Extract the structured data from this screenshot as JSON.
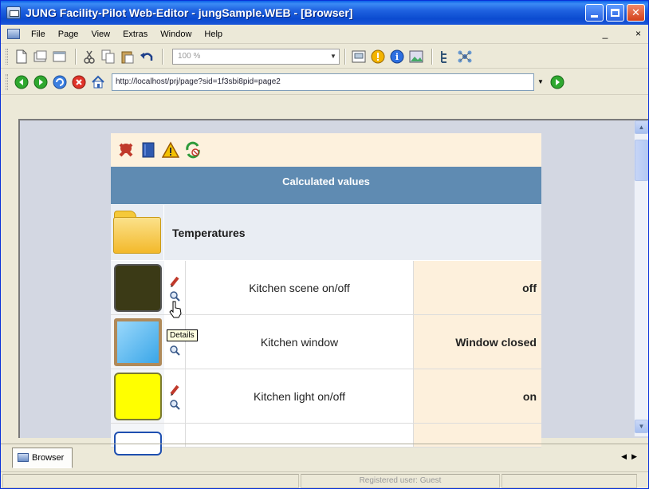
{
  "window": {
    "title": "JUNG Facility-Pilot Web-Editor - jungSample.WEB - [Browser]"
  },
  "menubar": {
    "items": [
      "File",
      "Page",
      "View",
      "Extras",
      "Window",
      "Help"
    ],
    "mdi_controls": "_     ×"
  },
  "toolbar": {
    "zoom_value": "100 %"
  },
  "address": {
    "url": "http://localhost/prj/page?sid=1f3sbi8pid=page2"
  },
  "page": {
    "header": "Calculated values",
    "group_title": "Temperatures",
    "items": [
      {
        "name": "Kitchen scene on/off",
        "value": "off",
        "thumb_color": "#3b3a16"
      },
      {
        "name": "Kitchen window",
        "value": "Window closed",
        "thumb_color": "#5bc0f2"
      },
      {
        "name": "Kitchen light on/off",
        "value": "on",
        "thumb_color": "#ffff00"
      }
    ],
    "tooltip": "Details"
  },
  "tabstrip": {
    "tab_label": "Browser"
  },
  "status": {
    "user": "Registered user: Guest"
  }
}
